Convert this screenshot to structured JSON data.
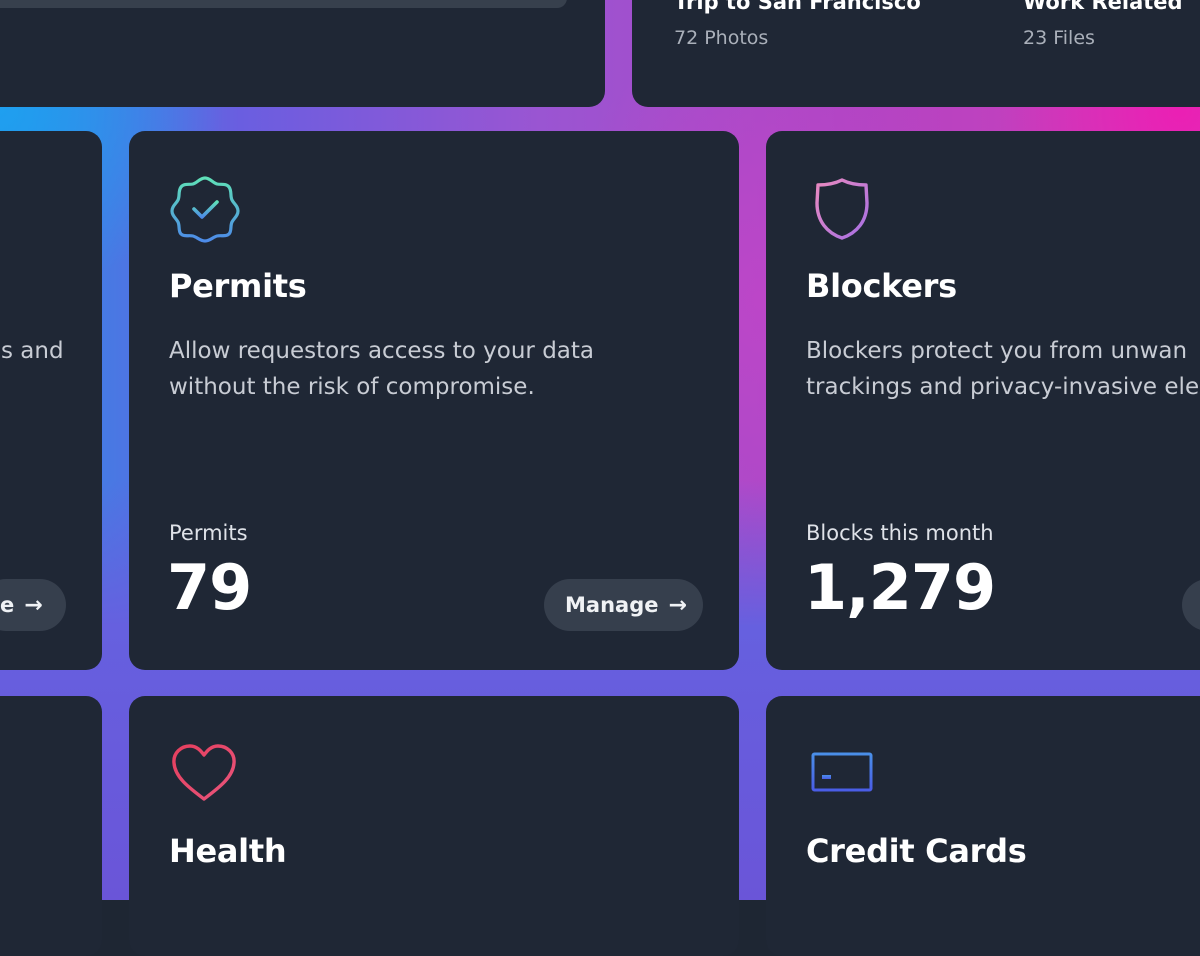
{
  "albums": [
    {
      "name": "Trip to San Francisco",
      "meta": "72 Photos"
    },
    {
      "name": "Work Related",
      "meta": "23 Files"
    }
  ],
  "left_card": {
    "desc_fragment": "s and",
    "button_fragment": "e"
  },
  "permits": {
    "icon": "verified-badge-icon",
    "title": "Permits",
    "description": "Allow requestors access to your data without the risk of compromise.",
    "stat_label": "Permits",
    "stat_value": "79",
    "button_label": "Manage"
  },
  "blockers": {
    "icon": "shield-icon",
    "title": "Blockers",
    "description_line1": "Blockers protect you from unwan",
    "description_line2": "trackings and privacy-invasive ele",
    "stat_label": "Blocks this month",
    "stat_value": "1,279"
  },
  "health": {
    "icon": "heart-icon",
    "title": "Health"
  },
  "credit_cards": {
    "icon": "credit-card-icon",
    "title": "Credit Cards"
  },
  "colors": {
    "card_bg": "#1f2735",
    "glow_blue": "#2c8fe6",
    "glow_purple": "#9a55d2",
    "glow_pink": "#ec1eb4",
    "pill_bg": "#363f4d"
  }
}
